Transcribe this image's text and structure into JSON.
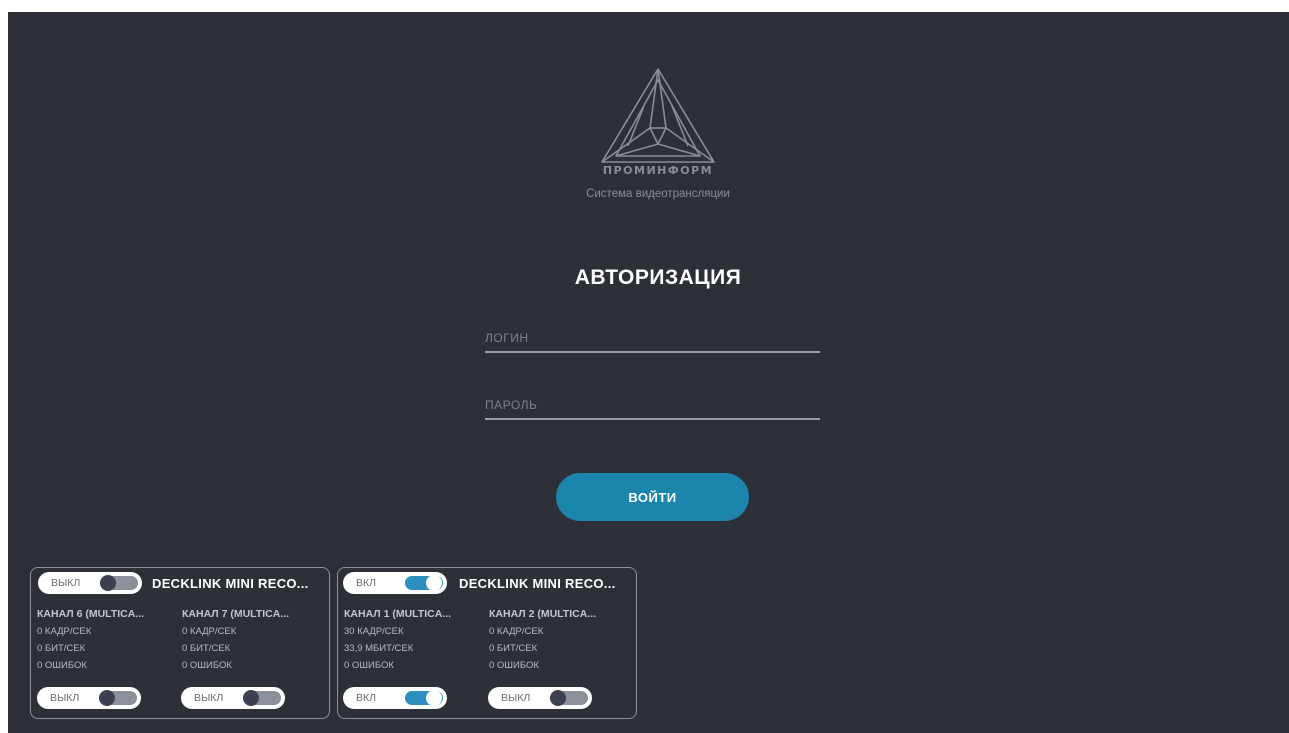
{
  "app": {
    "brand": "ПРОМИНФОРМ",
    "subtitle": "Система видеотрансляции",
    "accent_color": "#1b85ab",
    "background_color": "#2d3037"
  },
  "auth": {
    "title": "АВТОРИЗАЦИЯ",
    "login_placeholder": "ЛОГИН",
    "login_value": "",
    "password_placeholder": "ПАРОЛЬ",
    "password_value": "",
    "submit_label": "ВОЙТИ"
  },
  "devices": [
    {
      "title": "DECKLINK MINI RECO...",
      "toggle": {
        "label": "ВЫКЛ",
        "state": "off"
      },
      "channels": [
        {
          "name": "КАНАЛ 6 (MULTICA...",
          "fps": "0 КАДР/СЕК",
          "bitrate": "0 БИТ/СЕК",
          "errors": "0 ОШИБОК",
          "toggle": {
            "label": "ВЫКЛ",
            "state": "off"
          }
        },
        {
          "name": "КАНАЛ 7 (MULTICA...",
          "fps": "0 КАДР/СЕК",
          "bitrate": "0 БИТ/СЕК",
          "errors": "0 ОШИБОК",
          "toggle": {
            "label": "ВЫКЛ",
            "state": "off"
          }
        }
      ]
    },
    {
      "title": "DECKLINK MINI RECO...",
      "toggle": {
        "label": "ВКЛ",
        "state": "on"
      },
      "channels": [
        {
          "name": "КАНАЛ 1 (MULTICA...",
          "fps": "30 КАДР/СЕК",
          "bitrate": "33,9 МБИТ/СЕК",
          "errors": "0 ОШИБОК",
          "toggle": {
            "label": "ВКЛ",
            "state": "on"
          }
        },
        {
          "name": "КАНАЛ 2 (MULTICA...",
          "fps": "0 КАДР/СЕК",
          "bitrate": "0 БИТ/СЕК",
          "errors": "0 ОШИБОК",
          "toggle": {
            "label": "ВЫКЛ",
            "state": "off"
          }
        }
      ]
    }
  ],
  "icons": {
    "logo": "triangle-logo-icon",
    "toggle_knob": "toggle-knob-icon"
  }
}
